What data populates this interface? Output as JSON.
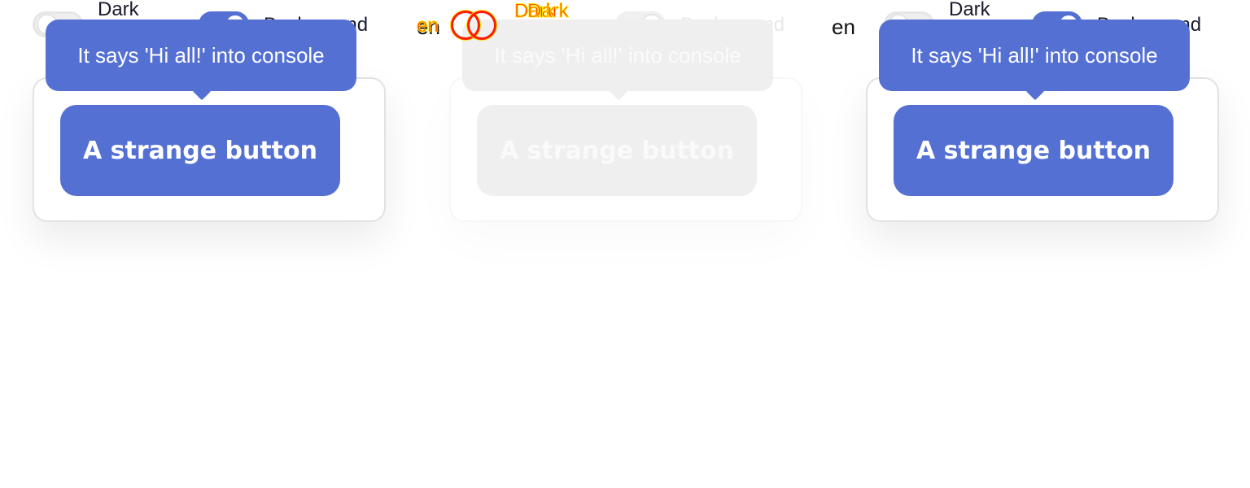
{
  "toolbar": {
    "dark_label": "Dark",
    "background_label": "Background",
    "lang": "en"
  },
  "card": {
    "button_label": "A strange button",
    "tooltip_text": "It says 'Hi all!' into console"
  },
  "glitch": {
    "texts": [
      "en",
      "Dark",
      "Dark"
    ]
  },
  "colors": {
    "accent": "#5470d3",
    "ghost": "#efefef",
    "glitch_red": "#ff2a00",
    "glitch_yellow": "#ffe100"
  }
}
